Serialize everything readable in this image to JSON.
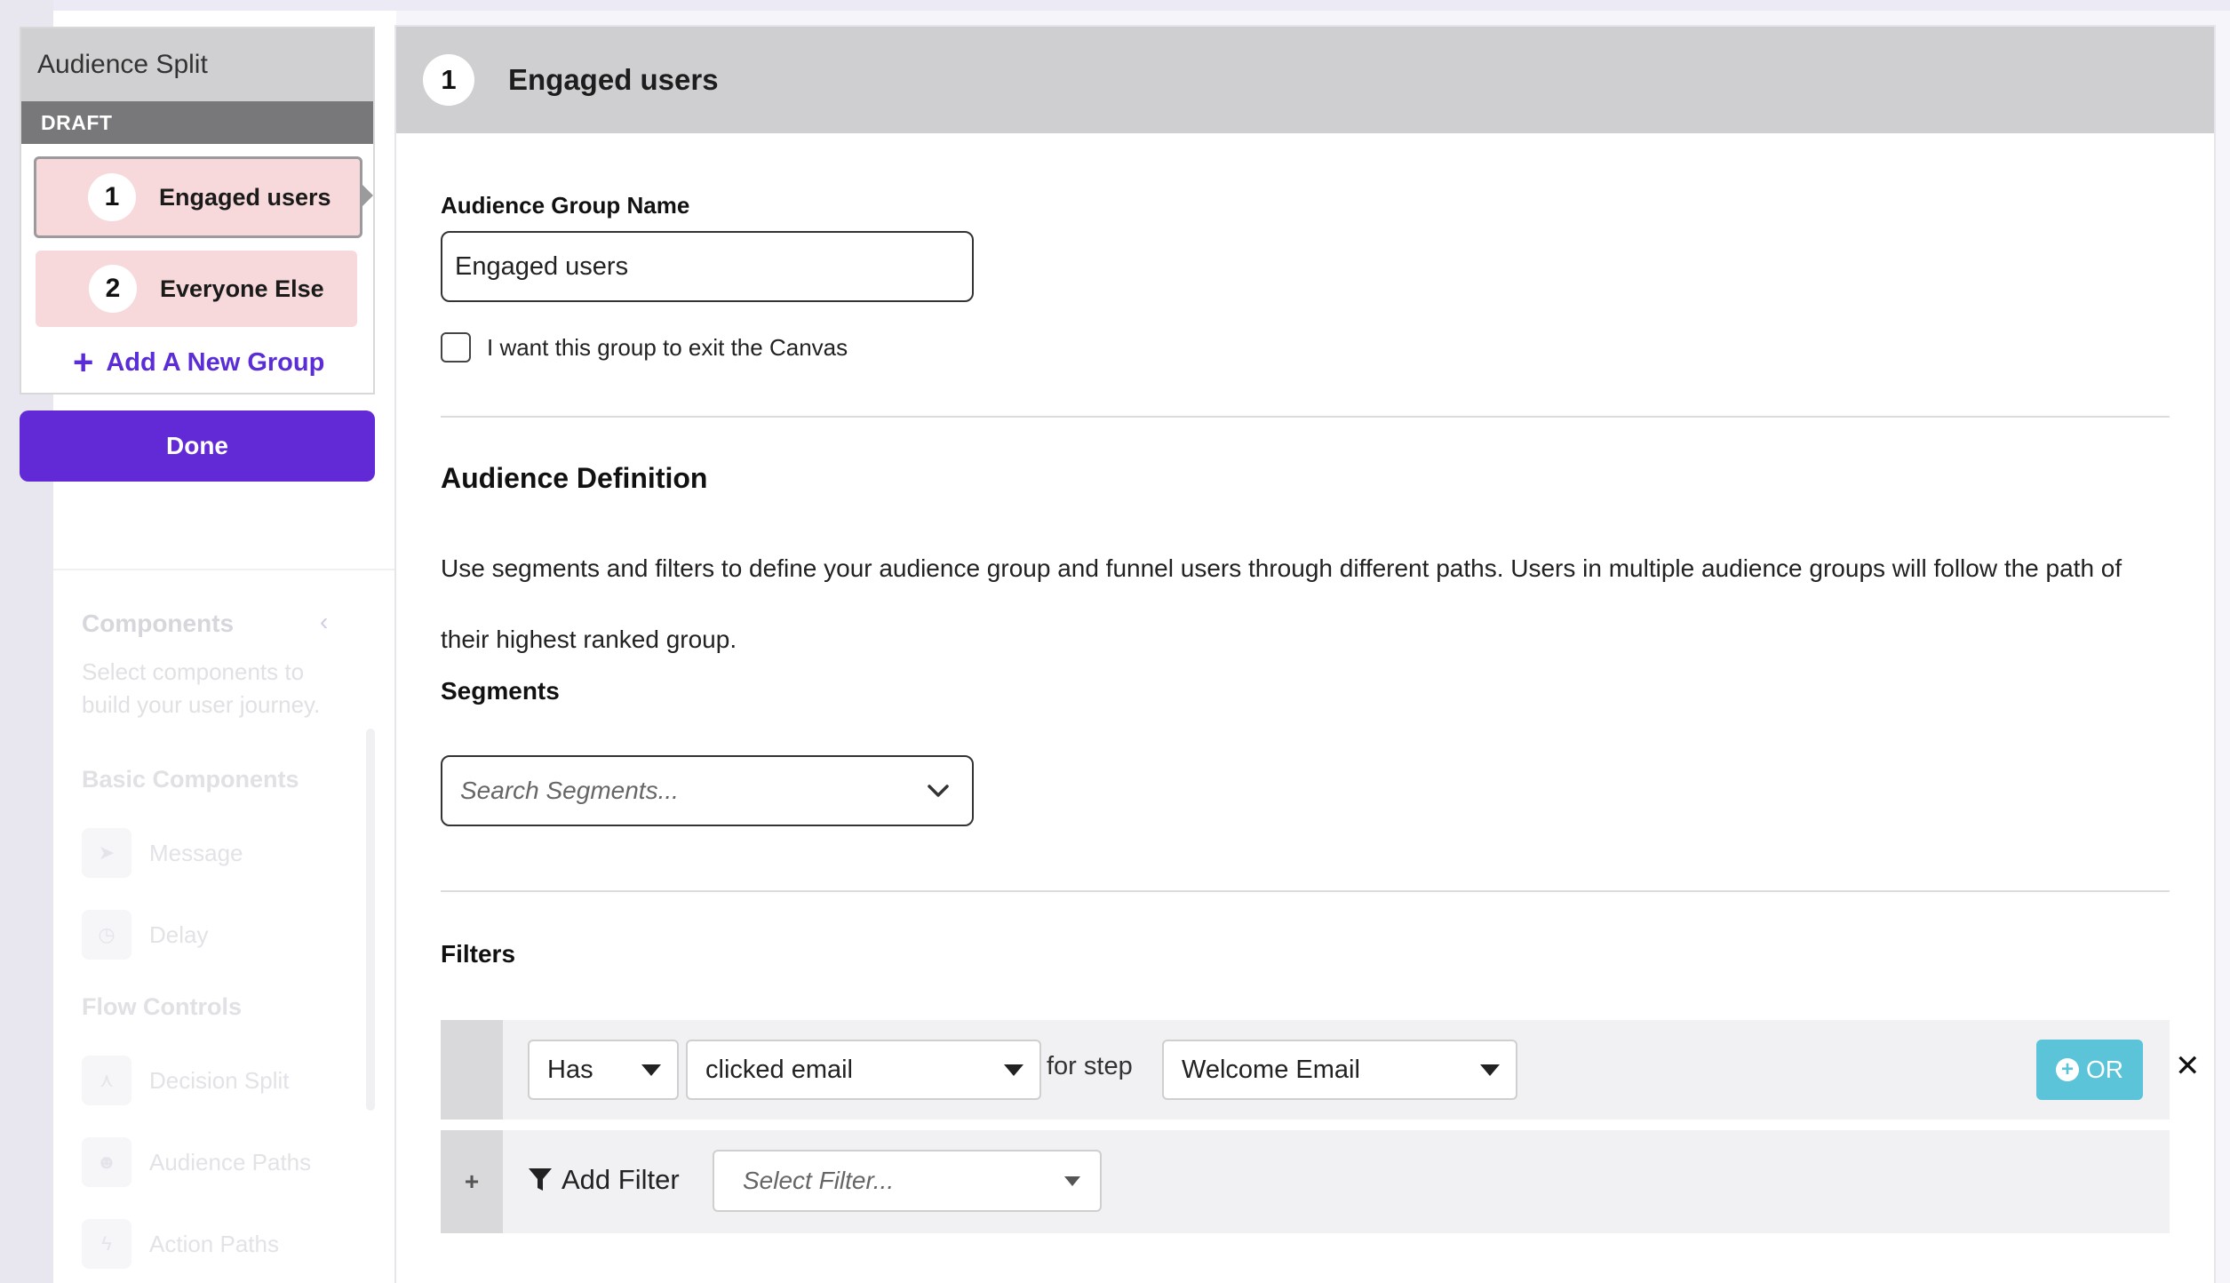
{
  "split_panel": {
    "title": "Audience Split",
    "status": "DRAFT",
    "groups": [
      {
        "number": "1",
        "name": "Engaged users"
      },
      {
        "number": "2",
        "name": "Everyone Else"
      }
    ],
    "add_group_label": "Add A New Group",
    "done_label": "Done"
  },
  "editor": {
    "header": {
      "number": "1",
      "title": "Engaged users"
    },
    "group_name_label": "Audience Group Name",
    "group_name_value": "Engaged users",
    "exit_checkbox_label": "I want this group to exit the Canvas",
    "exit_checkbox_checked": false,
    "audience_definition_title": "Audience Definition",
    "audience_definition_text": "Use segments and filters to define your audience group and funnel users through different paths. Users in multiple audience groups will follow the path of their highest ranked group.",
    "segments_label": "Segments",
    "segments_placeholder": "Search Segments...",
    "filters_label": "Filters",
    "filter": {
      "operator": "Has",
      "event": "clicked email",
      "for_step_label": "for step",
      "step": "Welcome Email",
      "or_label": "OR"
    },
    "add_filter_label": "Add Filter",
    "add_filter_placeholder": "Select Filter..."
  },
  "background": {
    "components_title": "Components",
    "components_desc": "Select components to build your user journey.",
    "basic_components": "Basic Components",
    "basic_items": [
      "Message",
      "Delay"
    ],
    "flow_controls": "Flow Controls",
    "flow_items": [
      "Decision Split",
      "Audience Paths",
      "Action Paths"
    ]
  },
  "colors": {
    "brand_purple": "#6229d6",
    "group_card_pink": "#f8d9db",
    "or_button_teal": "#5bc4d9"
  }
}
